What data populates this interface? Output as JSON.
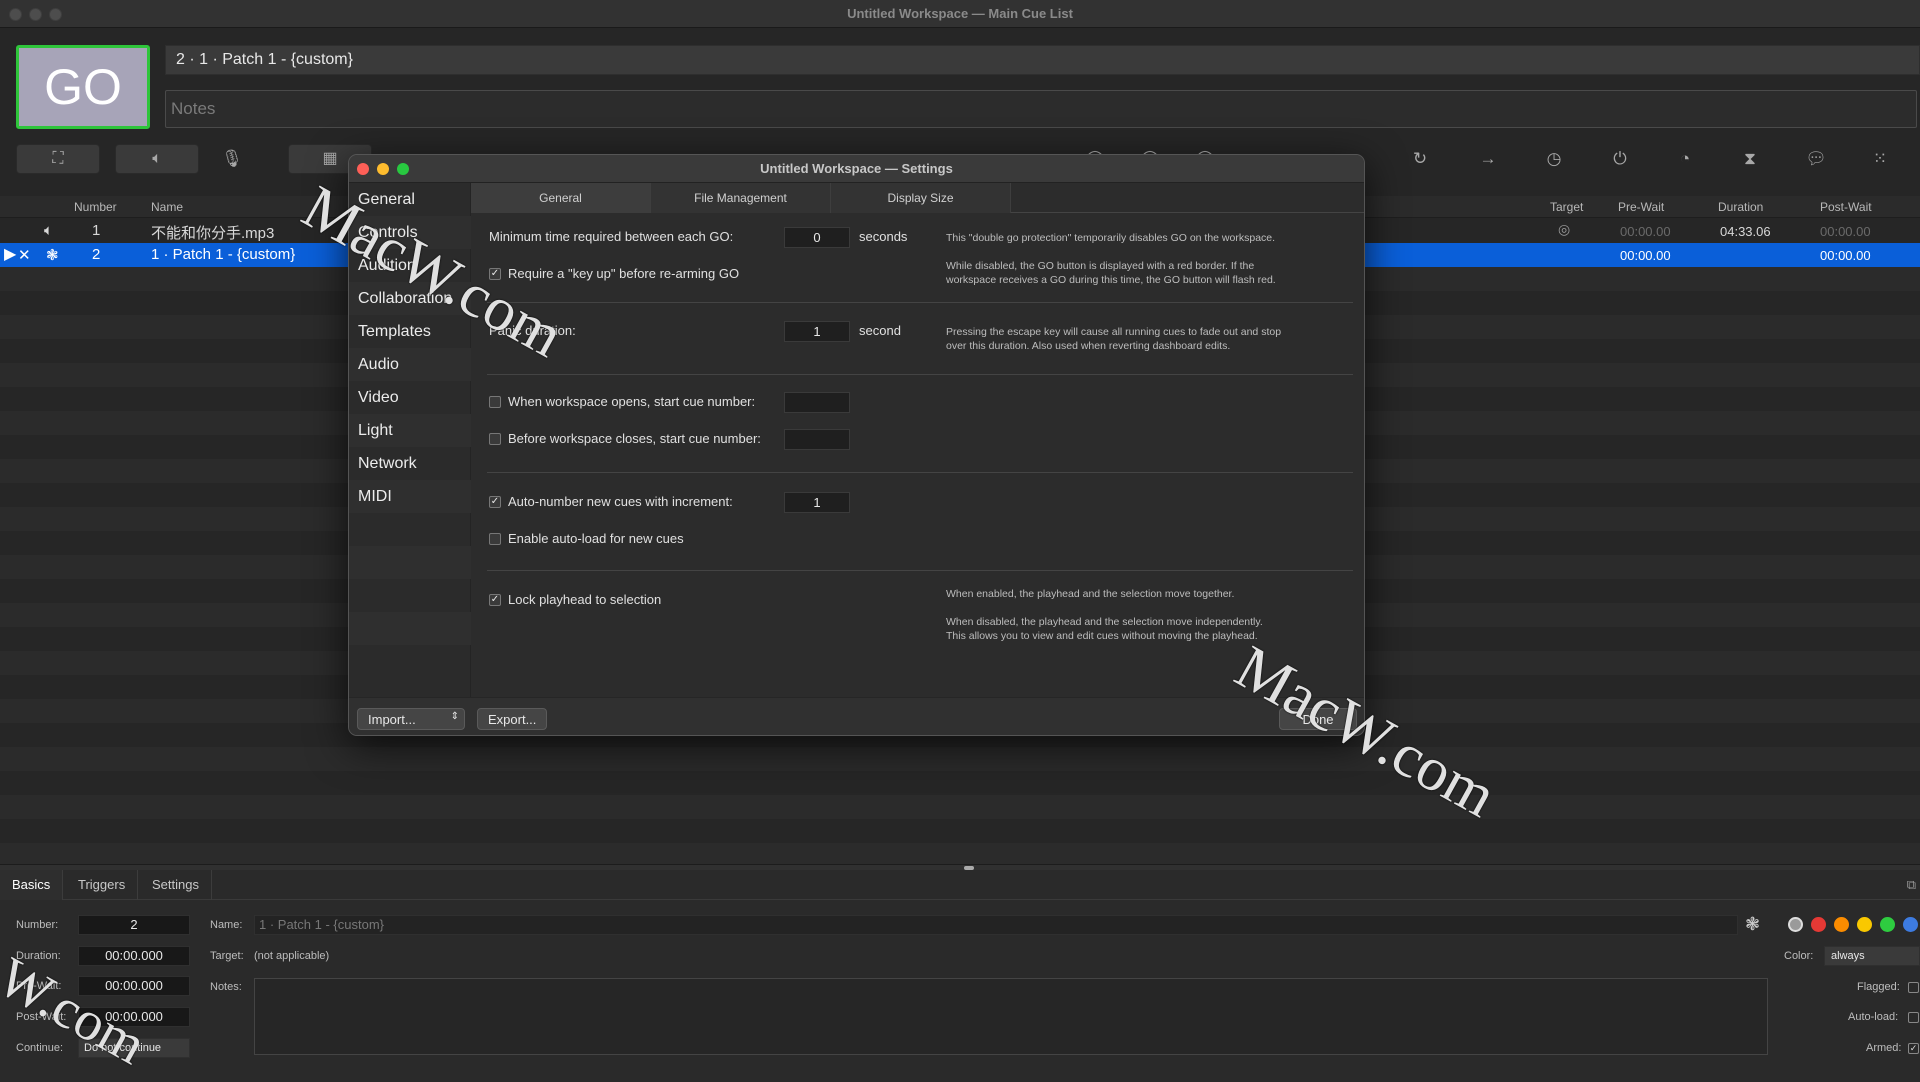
{
  "window": {
    "title": "Untitled Workspace — Main Cue List"
  },
  "go": {
    "label": "GO",
    "cue_title": "2 · 1 · Patch 1 - {custom}",
    "notes_placeholder": "Notes"
  },
  "toolbar": {
    "icons": [
      "fullscreen-icon",
      "audio-cue-icon",
      "mic-cue-icon",
      "video-cue-icon",
      "restart-icon",
      "goto-icon",
      "timer-icon",
      "stop-icon",
      "pause-icon",
      "wait-icon",
      "memo-icon",
      "grid-icon"
    ]
  },
  "cue_list": {
    "columns": {
      "number": "Number",
      "name": "Name",
      "target": "Target",
      "pre_wait": "Pre-Wait",
      "duration": "Duration",
      "post_wait": "Post-Wait"
    },
    "rows": [
      {
        "number": "1",
        "name": "不能和你分手.mp3",
        "pre_wait": "00:00.00",
        "duration": "04:33.06",
        "post_wait": "00:00.00"
      },
      {
        "number": "2",
        "name": "1 · Patch 1 - {custom}",
        "pre_wait": "00:00.00",
        "post_wait": "00:00.00"
      }
    ]
  },
  "settings": {
    "title": "Untitled Workspace — Settings",
    "sidebar": [
      "General",
      "Controls",
      "Audition",
      "Collaboration",
      "Templates",
      "Audio",
      "Video",
      "Light",
      "Network",
      "MIDI"
    ],
    "tabs": [
      "General",
      "File Management",
      "Display Size"
    ],
    "min_go_label": "Minimum time required between each GO:",
    "min_go_value": "0",
    "min_go_unit": "seconds",
    "min_go_help1": "This \"double go protection\" temporarily disables GO on the workspace.",
    "min_go_help2a": "While disabled, the GO button is displayed with a red border. If the",
    "min_go_help2b": "workspace receives a GO during this time, the GO button will flash red.",
    "key_up_label": "Require a \"key up\" before re-arming GO",
    "panic_label": "Panic duration:",
    "panic_value": "1",
    "panic_unit": "second",
    "panic_help_a": "Pressing the escape key will cause all running cues to fade out and stop",
    "panic_help_b": "over this duration. Also used when reverting dashboard edits.",
    "opens_label": "When workspace opens, start cue number:",
    "closes_label": "Before workspace closes, start cue number:",
    "autonum_label": "Auto-number new cues with increment:",
    "autonum_value": "1",
    "autoload_label": "Enable auto-load for new cues",
    "lock_label": "Lock playhead to selection",
    "lock_help1": "When enabled, the playhead and the selection move together.",
    "lock_help2a": "When disabled, the playhead and the selection move independently.",
    "lock_help2b": "This allows you to view and edit cues without moving the playhead.",
    "import_label": "Import...",
    "export_label": "Export...",
    "done_label": "Done"
  },
  "inspector": {
    "tabs": [
      "Basics",
      "Triggers",
      "Settings"
    ],
    "number_label": "Number:",
    "number_value": "2",
    "duration_label": "Duration:",
    "duration_value": "00:00.000",
    "prewait_label": "Pre-Wait:",
    "prewait_value": "00:00.000",
    "postwait_label": "Post-Wait:",
    "postwait_value": "00:00.000",
    "continue_label": "Continue:",
    "continue_value": "Do not continue",
    "name_label": "Name:",
    "name_value": "1 · Patch 1 - {custom}",
    "target_label": "Target:",
    "target_value": "(not applicable)",
    "notes_label": "Notes:",
    "color_label": "Color:",
    "color_value": "always",
    "flagged_label": "Flagged:",
    "autoload_label": "Auto-load:",
    "armed_label": "Armed:",
    "swatch_colors": [
      "#9a9a9a",
      "#e53935",
      "#fb8c00",
      "#f9c800",
      "#2ecc40",
      "#3d7be0",
      "#a020f0"
    ]
  },
  "watermark": {
    "text": "MacW.com"
  }
}
